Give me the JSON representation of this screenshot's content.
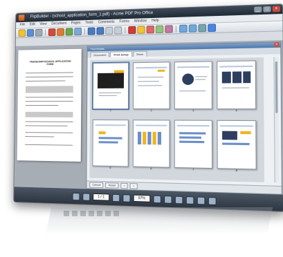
{
  "window": {
    "title": "FlipBuilder - (school_application_form_1.pdf) - Acme PDF Pro Office",
    "buttons": [
      "_",
      "□",
      "×"
    ]
  },
  "menubar": [
    "File",
    "Edit",
    "View",
    "Document",
    "Pages",
    "Tools",
    "Comments",
    "Forms",
    "Window",
    "Help"
  ],
  "document": {
    "form_title": "TRANSCRIPT/SCHOOL APPLICATION FORM"
  },
  "thumbnail_panel": {
    "title": "Thumbnails",
    "close": "×",
    "tabs": [
      "Document",
      "Print Setup",
      "Show"
    ],
    "active_tab": "Print Setup",
    "pages": [
      "1",
      "2",
      "3",
      "4",
      "5",
      "6",
      "7",
      "8"
    ],
    "footer_buttons": [
      "Cancel",
      "Reset",
      "<",
      ">"
    ]
  },
  "statusbar": {
    "page_field": "1 / 1",
    "zoom_field": "97%"
  },
  "icons": [
    "app-icon",
    "open-icon",
    "save-icon",
    "print-icon",
    "zoom-in-icon",
    "zoom-out-icon",
    "first-page-icon",
    "prev-page-icon",
    "next-page-icon",
    "last-page-icon"
  ],
  "colors": {
    "titlebar": "#2a3542",
    "accent_orange": "#f1b420",
    "accent_blue": "#6b8fc9",
    "selection": "#3a6fb0"
  }
}
